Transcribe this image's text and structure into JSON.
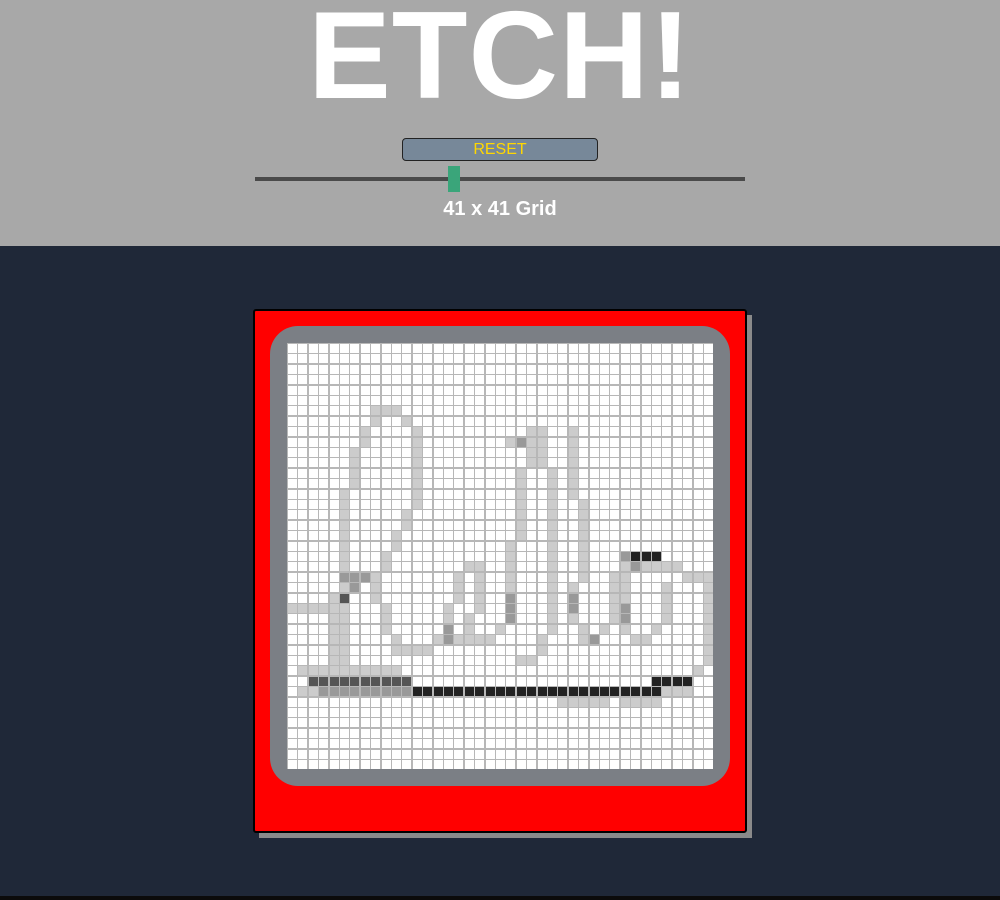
{
  "header": {
    "title": "ETCH!",
    "reset_label": "RESET",
    "grid_label": "41 x 41 Grid"
  },
  "slider": {
    "value": 41,
    "fill_fraction": 0.4
  },
  "grid": {
    "size": 41,
    "cell_color": "#ffffff",
    "line_color": "#b7b7b7",
    "light_shade": "#cccccc",
    "mid_shade": "#999999",
    "dark_shade": "#555555",
    "darkest_shade": "#222222"
  },
  "colors": {
    "header_bg": "#a8a8a8",
    "page_bg": "#1f2838",
    "frame": "#ff0000",
    "screen": "#7b7f85",
    "button_bg": "#778899",
    "button_text": "#ffd700",
    "thumb": "#3aa57a"
  }
}
